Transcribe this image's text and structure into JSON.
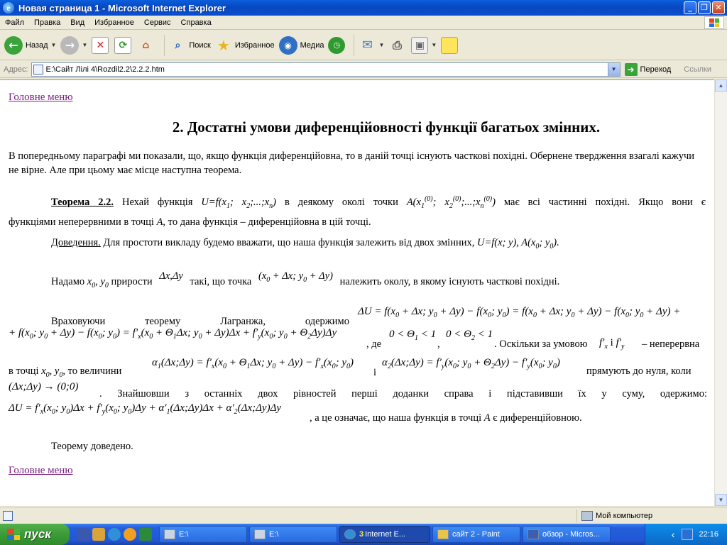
{
  "window": {
    "title": "Новая страница 1 - Microsoft Internet Explorer"
  },
  "menu": [
    "Файл",
    "Правка",
    "Вид",
    "Избранное",
    "Сервис",
    "Справка"
  ],
  "toolbar": {
    "back": "Назад",
    "search": "Поиск",
    "favorites": "Избранное",
    "media": "Медиа"
  },
  "address": {
    "label": "Адрес:",
    "value": "E:\\Сайт Лілі 4\\Rozdil2.2\\2.2.2.htm",
    "go": "Переход",
    "links": "Ссылки"
  },
  "page": {
    "main_menu_link": "Головне меню",
    "heading": "2. Достатні умови диференційовності функції багатьох змінних.",
    "intro": "В попередньому параграфі ми показали, що, якщо функція диференційовна, то в даній точці існують часткові похідні. Обернене твердження взагалі кажучи не вірне. Але при цьому має місце наступна теорема.",
    "theorem_label": "Теорема 2.2.",
    "theorem_a": "Нехай функція",
    "theorem_u": "U=f(x",
    "theorem_b": "в деякому околі точки",
    "theorem_c": "має всі частинні похідні. Якщо вони є",
    "theorem_d": "функціями неперервними в точці",
    "theorem_A": "A",
    "theorem_e": ", то дана функція – диференційовна в цій точці.",
    "proof_label": "Доведення.",
    "proof_text": "Для простоти викладу будемо вважати, що наша функція залежить від двох змінних,",
    "proof_formula": "U=f(x; y), A(x",
    "increments_a": "Надамо",
    "increments_b": "прирости",
    "increments_c": "такі, що точка",
    "increments_d": "належить околу, в якому існують часткові похідні.",
    "lagrange_words": [
      "Враховуючи",
      "теорему",
      "Лагранжа,",
      "одержимо"
    ],
    "where": ", де",
    "since": ". Оскільки за умовою",
    "and": "і",
    "continuous": "– неперервна",
    "in_point": "в точці",
    "then_values": "то величини",
    "i": "і",
    "tend_zero": "прямують до нуля, коли",
    "finding": ". Знайшовши з останніх двох рівностей перші доданки справа і підставивши їх у суму, одержимо:",
    "conclusion": ", а це означає, що наша функція в точці",
    "conclusion_b": "є диференційовною.",
    "proved": "Теорему доведено."
  },
  "status": {
    "zone": "Мой компьютер"
  },
  "taskbar": {
    "start": "пуск",
    "tasks": [
      {
        "label": "E:\\",
        "active": false
      },
      {
        "label": "E:\\",
        "active": false
      },
      {
        "count": "3",
        "label": "Internet E...",
        "active": true
      },
      {
        "label": "сайт 2 - Paint",
        "active": false
      },
      {
        "label": "обзор - Micros...",
        "active": false
      }
    ],
    "lang": "UK",
    "clock": "22:16"
  }
}
